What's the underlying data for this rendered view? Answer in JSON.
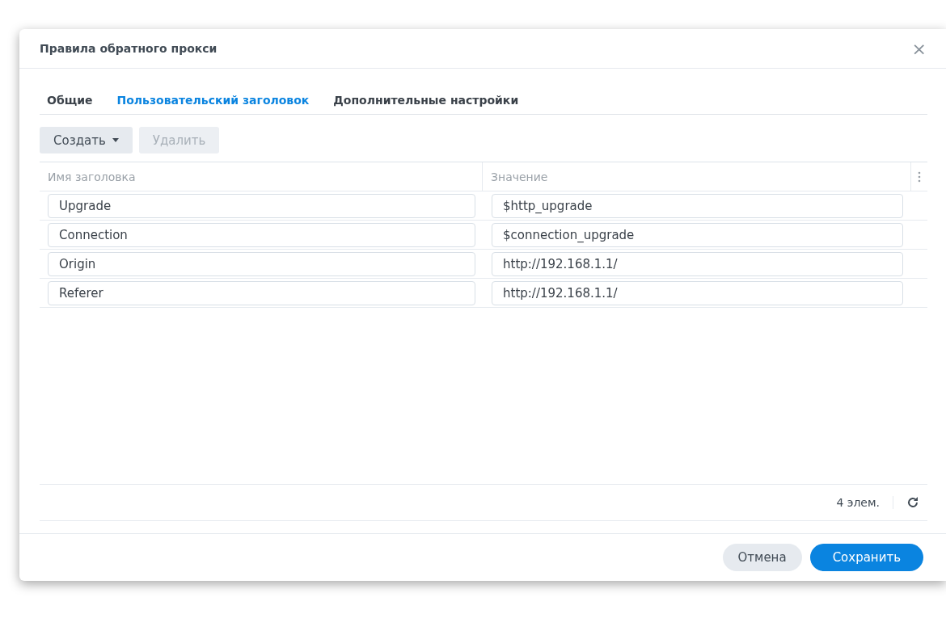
{
  "window": {
    "title": "Правила обратного прокси",
    "close": "×"
  },
  "tabs": [
    {
      "label": "Общие",
      "selected": false
    },
    {
      "label": "Пользовательский заголовок",
      "selected": true
    },
    {
      "label": "Дополнительные настройки",
      "selected": false
    }
  ],
  "toolbar": [
    {
      "label": "Создать",
      "kind": "dropdown",
      "disabled": false
    },
    {
      "label": "Удалить",
      "kind": "plain",
      "disabled": true
    }
  ],
  "table": {
    "columns": [
      "Имя заголовка",
      "Значение"
    ],
    "rows": [
      [
        "Upgrade",
        "$http_upgrade"
      ],
      [
        "Connection",
        "$connection_upgrade"
      ],
      [
        "Origin",
        "http://192.168.1.1/"
      ],
      [
        "Referer",
        "http://192.168.1.1/"
      ]
    ],
    "count": "4 элем."
  },
  "buttons": [
    {
      "label": "Отмена",
      "kind": "secondary"
    },
    {
      "label": "Сохранить",
      "kind": "primary"
    }
  ]
}
